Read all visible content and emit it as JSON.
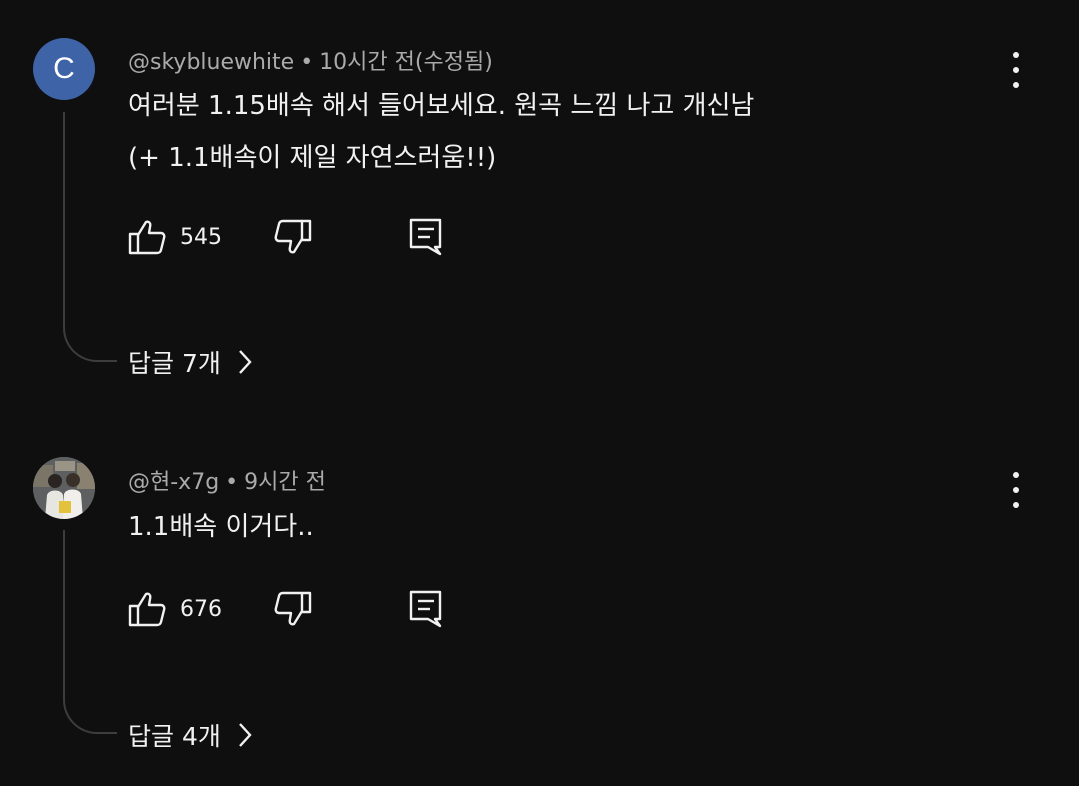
{
  "comments": [
    {
      "avatar_letter": "C",
      "avatar_color": "#3f63a7",
      "author": "@skybluewhite",
      "separator": "•",
      "time": "10시간 전(수정됨)",
      "lines": [
        "여러분 1.15배속 해서 들어보세요. 원곡 느낌 나고 개신남",
        "(+ 1.1배속이 제일 자연스러움!!)"
      ],
      "likes": "545",
      "replies_label": "답글 7개"
    },
    {
      "avatar_letter": "",
      "author": "@현-x7g",
      "separator": "•",
      "time": "9시간 전",
      "lines": [
        "1.1배속 이거다.."
      ],
      "likes": "676",
      "replies_label": "답글 4개"
    }
  ],
  "icons": {
    "like": "thumb-up-icon",
    "dislike": "thumb-down-icon",
    "reply": "comment-icon",
    "more": "more-vertical-icon",
    "chevron": "chevron-right-icon"
  }
}
